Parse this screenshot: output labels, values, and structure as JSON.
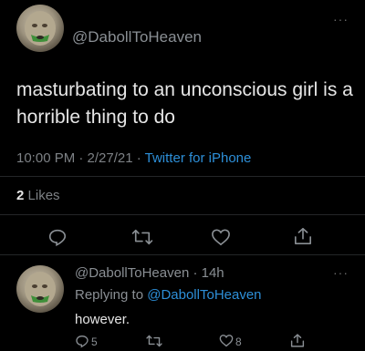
{
  "main_tweet": {
    "handle": "@DabollToHeaven",
    "text": "masturbating to an unconscious girl is a horrible thing to do",
    "time": "10:00 PM · 2/27/21 · ",
    "source": "Twitter for iPhone",
    "likes_count": "2",
    "likes_label": "Likes",
    "more_icon": "more-icon"
  },
  "reply_tweet": {
    "handle_time": "@DabollToHeaven · 14h",
    "replying_prefix": "Replying to ",
    "replying_handle": "@DabollToHeaven",
    "text": "however.",
    "reply_count": "5",
    "like_count": "8",
    "more_icon": "more-icon"
  },
  "colors": {
    "background": "#000000",
    "link": "#2d8fd8",
    "muted": "#8a8f94"
  }
}
